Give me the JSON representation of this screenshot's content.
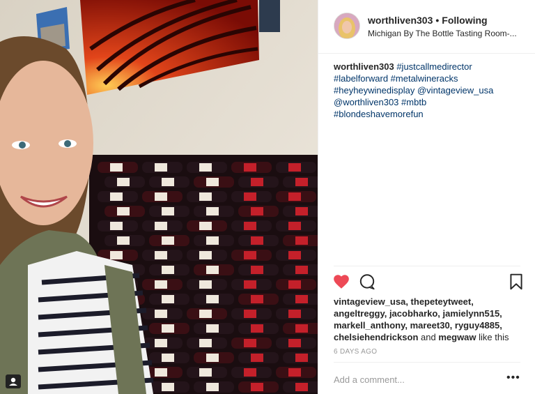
{
  "header": {
    "username": "worthliven303",
    "separator": "•",
    "follow_status": "Following",
    "location": "Michigan By The Bottle Tasting Room-..."
  },
  "caption": {
    "username": "worthliven303",
    "tokens": [
      "#justcallmedirector",
      "#labelforward",
      "#metalwineracks",
      "#heyheywinedisplay",
      "@vintageview_usa",
      "@worthliven303",
      "#mbtb",
      "#blondeshavemorefun"
    ]
  },
  "likes": {
    "names_line": "vintageview_usa, thepeteytweet, angeltreggy, jacobharko, jamielynn515, markell_anthony, mareet30, ryguy4885, chelsiehendrickson",
    "and_word": "and",
    "last_name": "megwaw",
    "suffix": "like this"
  },
  "timestamp": "6 DAYS AGO",
  "comment": {
    "placeholder": "Add a comment..."
  },
  "more_label": "•••",
  "icons": [
    "heart-icon",
    "comment-icon",
    "bookmark-icon",
    "profile-badge-icon",
    "more-options-icon"
  ],
  "colors": {
    "like_red": "#ed4956",
    "link_blue": "#003569",
    "text": "#262626",
    "muted": "#999999"
  }
}
